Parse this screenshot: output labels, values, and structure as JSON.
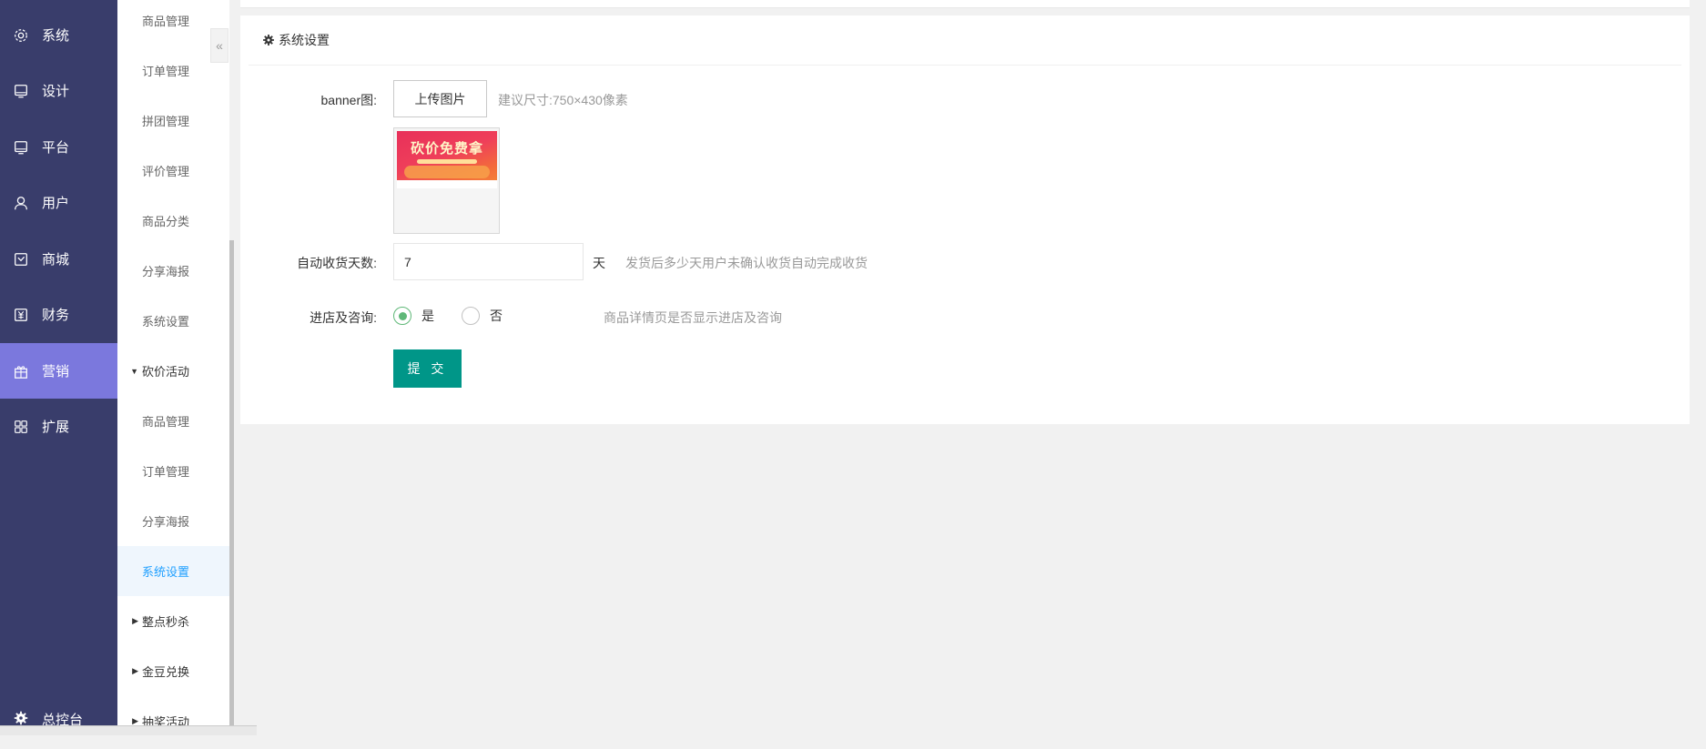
{
  "left_nav": {
    "items": [
      {
        "label": "系统",
        "icon": "gear-outline-icon"
      },
      {
        "label": "设计",
        "icon": "monitor-icon"
      },
      {
        "label": "平台",
        "icon": "monitor-icon"
      },
      {
        "label": "用户",
        "icon": "user-icon"
      },
      {
        "label": "商城",
        "icon": "shop-icon"
      },
      {
        "label": "财务",
        "icon": "finance-icon"
      },
      {
        "label": "营销",
        "icon": "gift-icon",
        "active": true
      },
      {
        "label": "扩展",
        "icon": "grid-icon"
      }
    ],
    "footer_label": "总控台"
  },
  "sub_nav": {
    "items": [
      {
        "label": "商品管理"
      },
      {
        "label": "订单管理"
      },
      {
        "label": "拼团管理"
      },
      {
        "label": "评价管理"
      },
      {
        "label": "商品分类"
      },
      {
        "label": "分享海报"
      },
      {
        "label": "系统设置"
      },
      {
        "label": "砍价活动",
        "group": true,
        "expanded": true
      },
      {
        "label": "商品管理"
      },
      {
        "label": "订单管理"
      },
      {
        "label": "分享海报"
      },
      {
        "label": "系统设置",
        "active": true
      },
      {
        "label": "整点秒杀",
        "group": true,
        "expanded": false
      },
      {
        "label": "金豆兑换",
        "group": true,
        "expanded": false
      },
      {
        "label": "抽奖活动",
        "group": true,
        "expanded": false
      }
    ],
    "collapse_glyph": "«"
  },
  "card": {
    "title": "系统设置"
  },
  "form": {
    "banner": {
      "label": "banner图:",
      "upload_label": "上传图片",
      "hint": "建议尺寸:750×430像素",
      "image_title": "砍价免费拿"
    },
    "auto_receive": {
      "label": "自动收货天数:",
      "value": "7",
      "unit": "天",
      "hint": "发货后多少天用户未确认收货自动完成收货"
    },
    "shop_consult": {
      "label": "进店及咨询:",
      "options": [
        {
          "label": "是",
          "checked": true
        },
        {
          "label": "否",
          "checked": false
        }
      ],
      "hint": "商品详情页是否显示进店及咨询"
    },
    "submit_label": "提 交"
  },
  "colors": {
    "nav_bg": "#393D6B",
    "nav_active": "#7B78DD",
    "sub_active_text": "#1E9FFF",
    "submit": "#009688",
    "radio_checked": "#5FB878"
  }
}
